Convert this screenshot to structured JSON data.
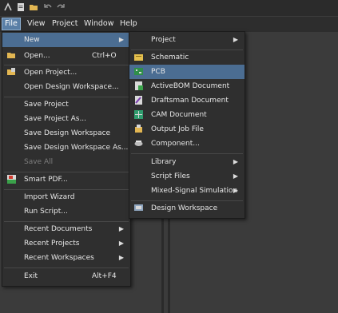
{
  "menubar": {
    "items": [
      {
        "label": "File",
        "active": true
      },
      {
        "label": "View",
        "active": false
      },
      {
        "label": "Project",
        "active": false
      },
      {
        "label": "Window",
        "active": false
      },
      {
        "label": "Help",
        "active": false
      }
    ]
  },
  "file_menu": {
    "new": "New",
    "open": "Open...",
    "open_shortcut": "Ctrl+O",
    "open_project": "Open Project...",
    "open_design_workspace": "Open Design Workspace...",
    "save_project": "Save Project",
    "save_project_as": "Save Project As...",
    "save_design_workspace": "Save Design Workspace",
    "save_design_workspace_as": "Save Design Workspace As...",
    "save_all": "Save All",
    "smart_pdf": "Smart PDF...",
    "import_wizard": "Import Wizard",
    "run_script": "Run Script...",
    "recent_documents": "Recent Documents",
    "recent_projects": "Recent Projects",
    "recent_workspaces": "Recent Workspaces",
    "exit": "Exit",
    "exit_shortcut": "Alt+F4"
  },
  "new_submenu": {
    "project": "Project",
    "schematic": "Schematic",
    "pcb": "PCB",
    "activebom": "ActiveBOM Document",
    "draftsman": "Draftsman Document",
    "cam": "CAM Document",
    "output_job": "Output Job File",
    "component": "Component...",
    "library": "Library",
    "script_files": "Script Files",
    "mixed_signal": "Mixed-Signal Simulation",
    "design_workspace": "Design Workspace"
  },
  "colors": {
    "highlight": "#4b6d92",
    "menu_bg": "#2f2f2f",
    "menubar_active": "#5a7fa6"
  }
}
